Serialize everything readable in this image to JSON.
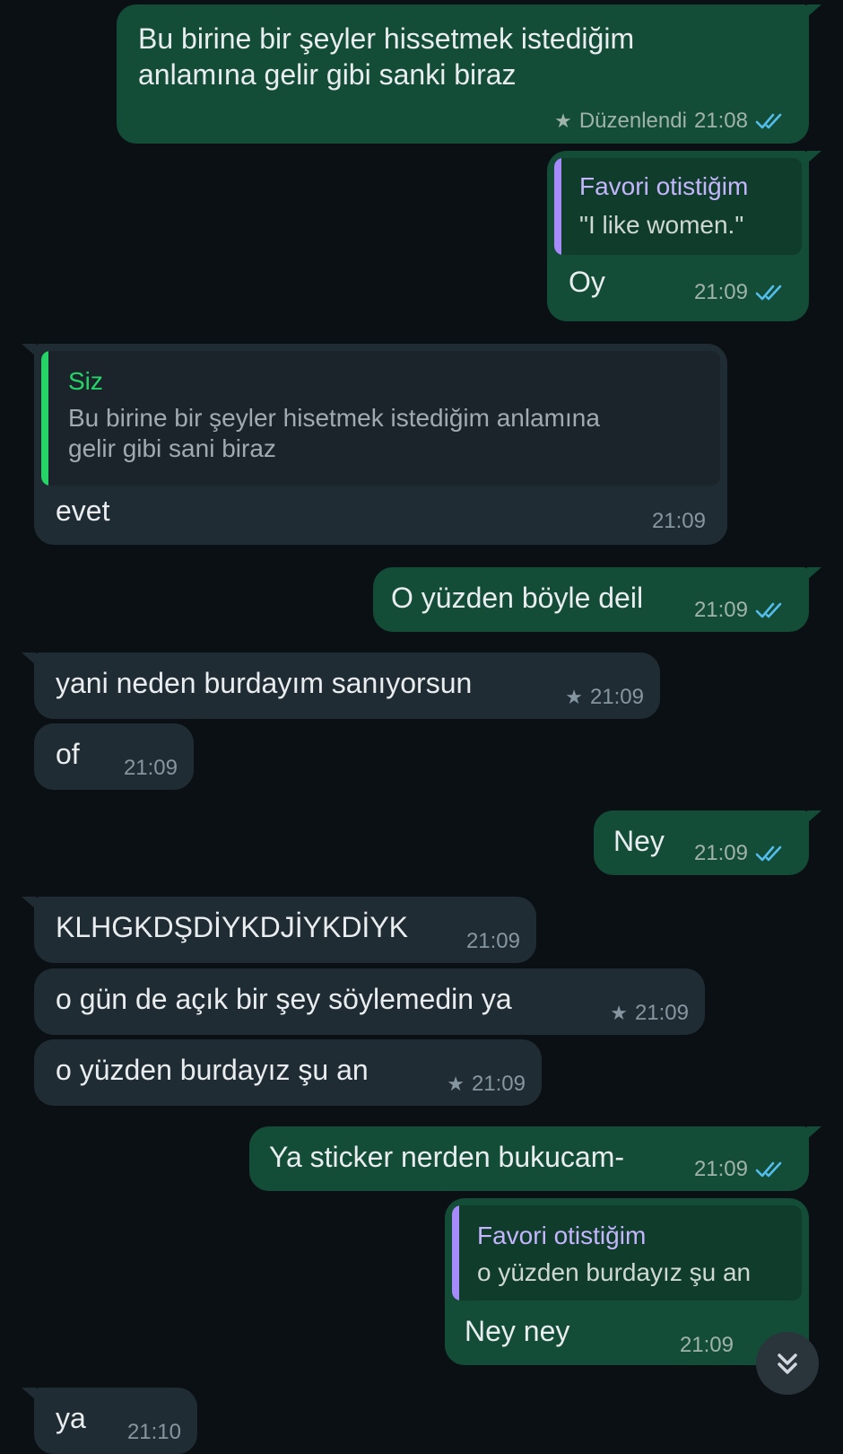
{
  "colors": {
    "outgoing_bubble": "#144d37",
    "incoming_bubble": "#202c33",
    "background": "#0b1014",
    "read_ticks": "#53bdeb",
    "quote_bar_purple": "#a78bfa",
    "quote_bar_green": "#25d366"
  },
  "messages": [
    {
      "direction": "out",
      "text_line1": "Bu birine bir şeyler hissetmek istediğim",
      "text_line2": "anlamına gelir gibi sanki biraz",
      "edited_label": "Düzenlendi",
      "time": "21:08",
      "starred": true,
      "status": "read"
    },
    {
      "direction": "out",
      "quote": {
        "name": "Favori otistiğim",
        "text": "\"I like women.\""
      },
      "text": "Oy",
      "time": "21:09",
      "status": "read"
    },
    {
      "direction": "in",
      "quote": {
        "name": "Siz",
        "text_line1": "Bu birine bir şeyler hisetmek istediğim anlamına",
        "text_line2": "gelir gibi sani biraz"
      },
      "text": "evet",
      "time": "21:09"
    },
    {
      "direction": "out",
      "text": "O yüzden böyle deil",
      "time": "21:09",
      "status": "read"
    },
    {
      "direction": "in",
      "text": "yani neden burdayım sanıyorsun",
      "time": "21:09",
      "starred": true
    },
    {
      "direction": "in",
      "text": "of",
      "time": "21:09"
    },
    {
      "direction": "out",
      "text": "Ney",
      "time": "21:09",
      "status": "read"
    },
    {
      "direction": "in",
      "text": "KLHGKDŞDİYKDJİYKDİYK",
      "time": "21:09"
    },
    {
      "direction": "in",
      "text": "o gün de açık bir şey söylemedin ya",
      "time": "21:09",
      "starred": true
    },
    {
      "direction": "in",
      "text": "o yüzden burdayız şu an",
      "time": "21:09",
      "starred": true
    },
    {
      "direction": "out",
      "text": "Ya sticker nerden bukucam-",
      "time": "21:09",
      "status": "read"
    },
    {
      "direction": "out",
      "quote": {
        "name": "Favori otistiğim",
        "text": "o yüzden burdayız şu an"
      },
      "text": "Ney ney",
      "time": "21:09",
      "status": "read"
    },
    {
      "direction": "in",
      "text": "ya",
      "time": "21:10"
    }
  ],
  "scroll_button": {
    "icon": "double-chevron-down-icon"
  }
}
